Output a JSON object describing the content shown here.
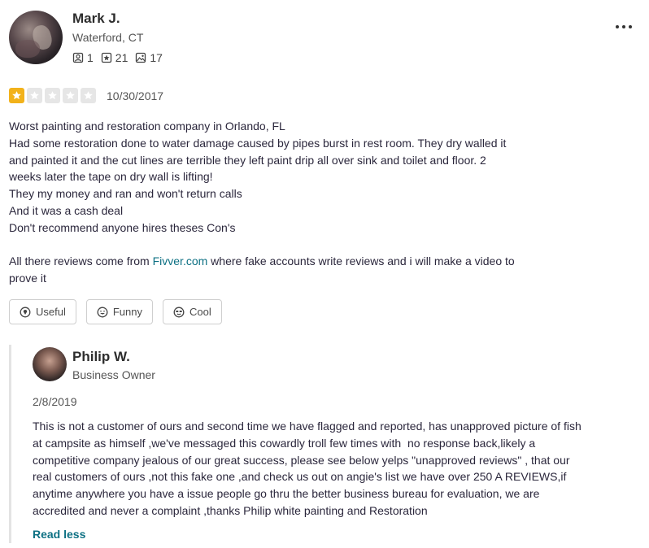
{
  "review": {
    "author": {
      "name": "Mark J.",
      "location": "Waterford, CT",
      "friends": "1",
      "reviews": "21",
      "photos": "17"
    },
    "rating": 1,
    "date": "10/30/2017",
    "body_lines": [
      "Worst painting and restoration company in Orlando, FL",
      "Had some restoration done to water damage caused by pipes burst in rest room. They dry walled it",
      "and painted it and the cut lines are terrible they left paint drip all over sink and toilet and floor. 2",
      "weeks later the tape on dry wall is lifting!",
      "They my money and ran and won't return calls",
      "And it was a cash deal",
      "Don't recommend anyone hires theses Con's"
    ],
    "fivver_pre": "All there reviews come from ",
    "fivver_link": "Fivver.com",
    "fivver_post": " where fake accounts write reviews and i will make a video to",
    "fivver_line2": "prove it",
    "buttons": {
      "useful": "Useful",
      "funny": "Funny",
      "cool": "Cool"
    }
  },
  "reply": {
    "name": "Philip W.",
    "role": "Business Owner",
    "date": "2/8/2019",
    "body_lines": [
      "This is not a customer of ours and second time we have flagged and reported, has unapproved picture of fish",
      "at campsite as himself ,we've messaged this cowardly troll few times with  no response back,likely a",
      "competitive company jealous of our great success, please see below yelps \"unapproved reviews\" , that our",
      "real customers of ours ,not this fake one ,and check us out on angie's list we have over 250 A REVIEWS,if",
      "anytime anywhere you have a issue people go thru the better business bureau for evaluation, we are",
      "accredited and never a complaint ,thanks Philip white painting and Restoration"
    ],
    "read_less": "Read less"
  },
  "colors": {
    "star_on": "#f2b21b",
    "star_off": "#e6e6e6",
    "link": "#0d7083"
  },
  "icons": [
    "friends-icon",
    "reviews-icon",
    "photos-icon",
    "star-icon",
    "useful-icon",
    "funny-icon",
    "cool-icon",
    "more-options-icon"
  ]
}
